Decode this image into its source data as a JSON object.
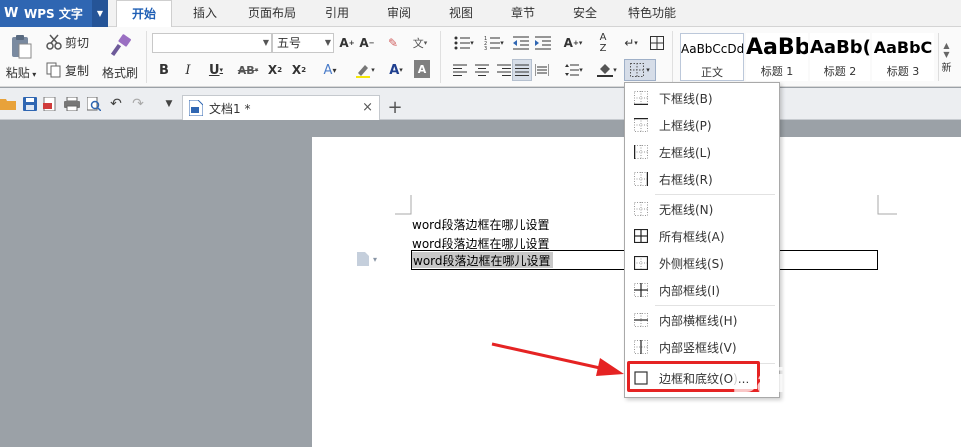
{
  "app": {
    "title": "WPS 文字"
  },
  "tabs": [
    {
      "label": "开始",
      "active": true
    },
    {
      "label": "插入"
    },
    {
      "label": "页面布局"
    },
    {
      "label": "引用"
    },
    {
      "label": "审阅"
    },
    {
      "label": "视图"
    },
    {
      "label": "章节"
    },
    {
      "label": "安全"
    },
    {
      "label": "特色功能"
    }
  ],
  "clipboard": {
    "cut": "剪切",
    "copy": "复制",
    "paste": "粘贴",
    "format_painter": "格式刷"
  },
  "font": {
    "size": "五号"
  },
  "styles": [
    {
      "sample": "AaBbCcDd",
      "name": "正文"
    },
    {
      "sample": "AaBb",
      "name": "标题 1"
    },
    {
      "sample": "AaBb(",
      "name": "标题 2"
    },
    {
      "sample": "AaBbC",
      "name": "标题 3"
    }
  ],
  "styles_more": "新",
  "document": {
    "tab_name": "文档1 *",
    "close": "×",
    "new_tab": "+",
    "lines": [
      "word段落边框在哪儿设置",
      "word段落边框在哪儿设置",
      "word段落边框在哪儿设置"
    ]
  },
  "border_menu": {
    "items": [
      {
        "label": "下框线(B)",
        "icon": "border-bottom-icon"
      },
      {
        "label": "上框线(P)",
        "icon": "border-top-icon"
      },
      {
        "label": "左框线(L)",
        "icon": "border-left-icon"
      },
      {
        "label": "右框线(R)",
        "icon": "border-right-icon"
      },
      {
        "label": "无框线(N)",
        "icon": "border-none-icon"
      },
      {
        "label": "所有框线(A)",
        "icon": "border-all-icon"
      },
      {
        "label": "外侧框线(S)",
        "icon": "border-outside-icon"
      },
      {
        "label": "内部框线(I)",
        "icon": "border-inside-icon"
      },
      {
        "label": "内部横框线(H)",
        "icon": "border-inside-horizontal-icon"
      },
      {
        "label": "内部竖框线(V)",
        "icon": "border-inside-vertical-icon"
      },
      {
        "label": "边框和底纹(O)...",
        "icon": "borders-shading-icon",
        "highlighted": true
      }
    ]
  },
  "watermark": {
    "brand": "Baidu",
    "product": "经验",
    "url": "jingyan.baidu.com"
  },
  "colors": {
    "accent": "#2f66b2",
    "highlight": "#e52323",
    "font_color": "#e01b1b",
    "highlighter": "#f5e70a"
  }
}
